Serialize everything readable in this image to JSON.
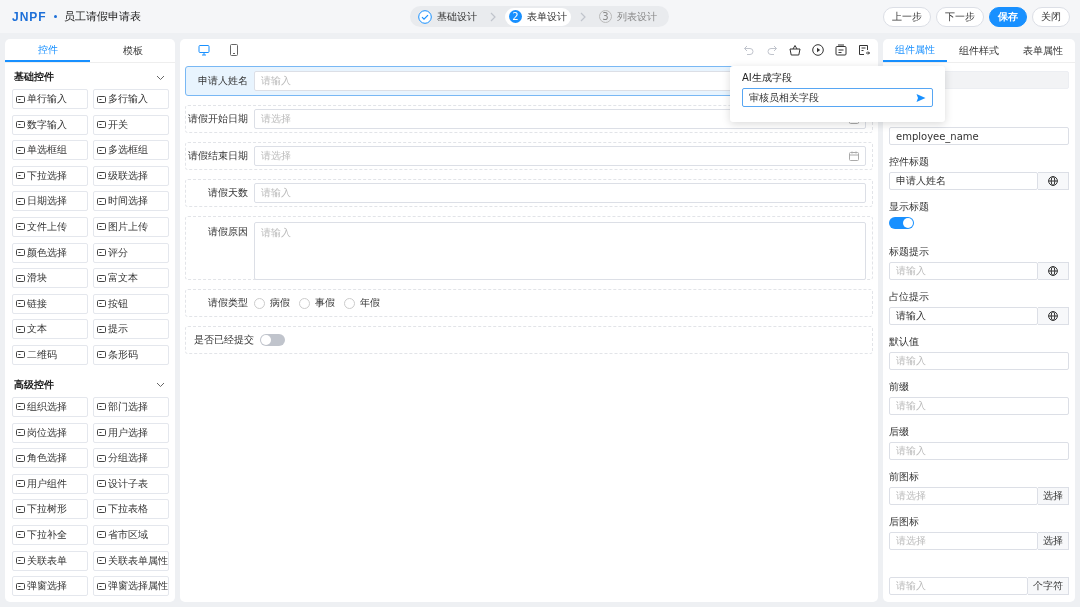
{
  "header": {
    "logo": "JNPF",
    "title": "员工请假申请表",
    "steps": [
      {
        "label": "基础设计",
        "done": true,
        "selected": false
      },
      {
        "number": "2",
        "label": "表单设计",
        "done": false,
        "selected": true
      },
      {
        "number": "3",
        "label": "列表设计",
        "done": false,
        "selected": false
      }
    ],
    "buttons": [
      {
        "label": "上一步",
        "kind": "plain"
      },
      {
        "label": "下一步",
        "kind": "plain"
      },
      {
        "label": "保存",
        "kind": "primary"
      },
      {
        "label": "关闭",
        "kind": "plain"
      }
    ]
  },
  "palette": {
    "tabs": [
      {
        "label": "控件",
        "selected": true
      },
      {
        "label": "模板",
        "selected": false
      }
    ],
    "groups": [
      {
        "title": "基础控件",
        "expanded": true,
        "items": [
          "单行输入",
          "多行输入",
          "数字输入",
          "开关",
          "单选框组",
          "多选框组",
          "下拉选择",
          "级联选择",
          "日期选择",
          "时间选择",
          "文件上传",
          "图片上传",
          "颜色选择",
          "评分",
          "滑块",
          "富文本",
          "链接",
          "按钮",
          "文本",
          "提示",
          "二维码",
          "条形码"
        ]
      },
      {
        "title": "高级控件",
        "expanded": true,
        "items": [
          "组织选择",
          "部门选择",
          "岗位选择",
          "用户选择",
          "角色选择",
          "分组选择",
          "用户组件",
          "设计子表",
          "下拉树形",
          "下拉表格",
          "下拉补全",
          "省市区域",
          "关联表单",
          "关联表单属性",
          "弹窗选择",
          "弹窗选择属性"
        ]
      }
    ]
  },
  "canvas": {
    "devices": [
      {
        "kind": "desktop",
        "selected": true
      },
      {
        "kind": "mobile",
        "selected": false
      }
    ],
    "history": [
      {
        "kind": "undo",
        "disabled": true
      },
      {
        "kind": "redo",
        "disabled": true
      }
    ],
    "fields": [
      {
        "label": "申请人姓名",
        "kind": "input",
        "placeholder": "请输入",
        "selected": true
      },
      {
        "label": "请假开始日期",
        "kind": "date",
        "placeholder": "请选择",
        "selected": false
      },
      {
        "label": "请假结束日期",
        "kind": "date",
        "placeholder": "请选择",
        "selected": false
      },
      {
        "label": "请假天数",
        "kind": "input",
        "placeholder": "请输入",
        "selected": false
      },
      {
        "label": "请假原因",
        "kind": "textarea",
        "placeholder": "请输入",
        "selected": false
      },
      {
        "label": "请假类型",
        "kind": "radio",
        "selected": false,
        "options": [
          {
            "label": "病假",
            "selected": false
          },
          {
            "label": "事假",
            "selected": false
          },
          {
            "label": "年假",
            "selected": false
          }
        ]
      },
      {
        "label": "是否已经提交",
        "kind": "switch",
        "on": false,
        "selected": false
      }
    ]
  },
  "ai_popup": {
    "title": "AI生成字段",
    "value": "审核员相关字段"
  },
  "properties": {
    "tabs": [
      {
        "label": "组件属性",
        "selected": true
      },
      {
        "label": "组件样式",
        "selected": false
      },
      {
        "label": "表单属性",
        "selected": false
      }
    ],
    "items": [
      {
        "kind": "input",
        "disabled": true
      },
      {
        "kind": "input",
        "value": "employee_name"
      },
      {
        "kind": "input",
        "label": "控件标题",
        "value": "申请人姓名",
        "globe_button": true
      },
      {
        "kind": "switch",
        "label": "显示标题",
        "on": true
      },
      {
        "kind": "input",
        "label": "标题提示",
        "placeholder": "请输入",
        "globe_button": true
      },
      {
        "kind": "input",
        "label": "占位提示",
        "value": "请输入",
        "globe_button": true
      },
      {
        "kind": "input",
        "label": "默认值",
        "placeholder": "请输入"
      },
      {
        "kind": "input",
        "label": "前缀",
        "placeholder": "请输入"
      },
      {
        "kind": "input",
        "label": "后缀",
        "placeholder": "请输入"
      },
      {
        "kind": "input",
        "label": "前图标",
        "placeholder": "请选择",
        "addon_text": "选择"
      },
      {
        "kind": "input",
        "label": "后图标",
        "placeholder": "请选择",
        "addon_text": "选择"
      },
      {
        "kind": "input",
        "placeholder": "请输入",
        "addon_text": "个字符"
      }
    ]
  }
}
